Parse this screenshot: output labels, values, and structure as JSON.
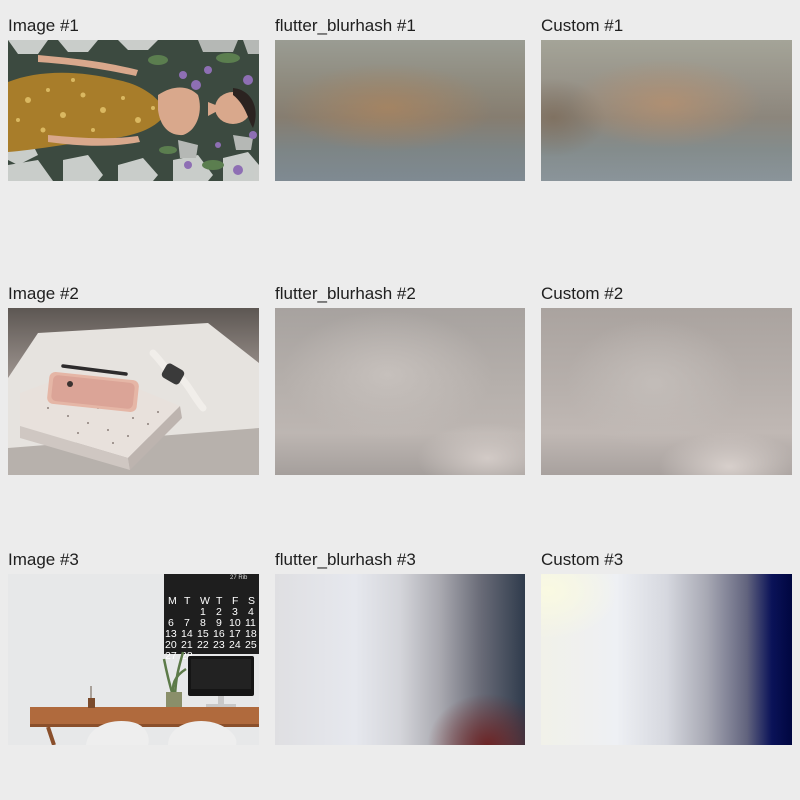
{
  "rows": [
    {
      "image_label": "Image #1",
      "flutter_label": "flutter_blurhash #1",
      "custom_label": "Custom #1",
      "image_desc": "woman-in-gold-sequin-dress"
    },
    {
      "image_label": "Image #2",
      "flutter_label": "flutter_blurhash #2",
      "custom_label": "Custom #2",
      "image_desc": "phone-notebook-watch"
    },
    {
      "image_label": "Image #3",
      "flutter_label": "flutter_blurhash #3",
      "custom_label": "Custom #3",
      "image_desc": "desk-calendar-computer"
    }
  ],
  "calendar": {
    "header": "27  Rib",
    "weekdays": [
      "M",
      "T",
      "W",
      "T",
      "F",
      "S"
    ],
    "weeks": [
      [
        "",
        "",
        "1",
        "2",
        "3",
        "4"
      ],
      [
        "6",
        "7",
        "8",
        "9",
        "10",
        "11"
      ],
      [
        "13",
        "14",
        "15",
        "16",
        "17",
        "18"
      ],
      [
        "20",
        "21",
        "22",
        "23",
        "24",
        "25"
      ],
      [
        "27",
        "28",
        "",
        "",
        "",
        ""
      ]
    ]
  },
  "colors": {
    "background": "#ececec",
    "text": "#202020"
  }
}
